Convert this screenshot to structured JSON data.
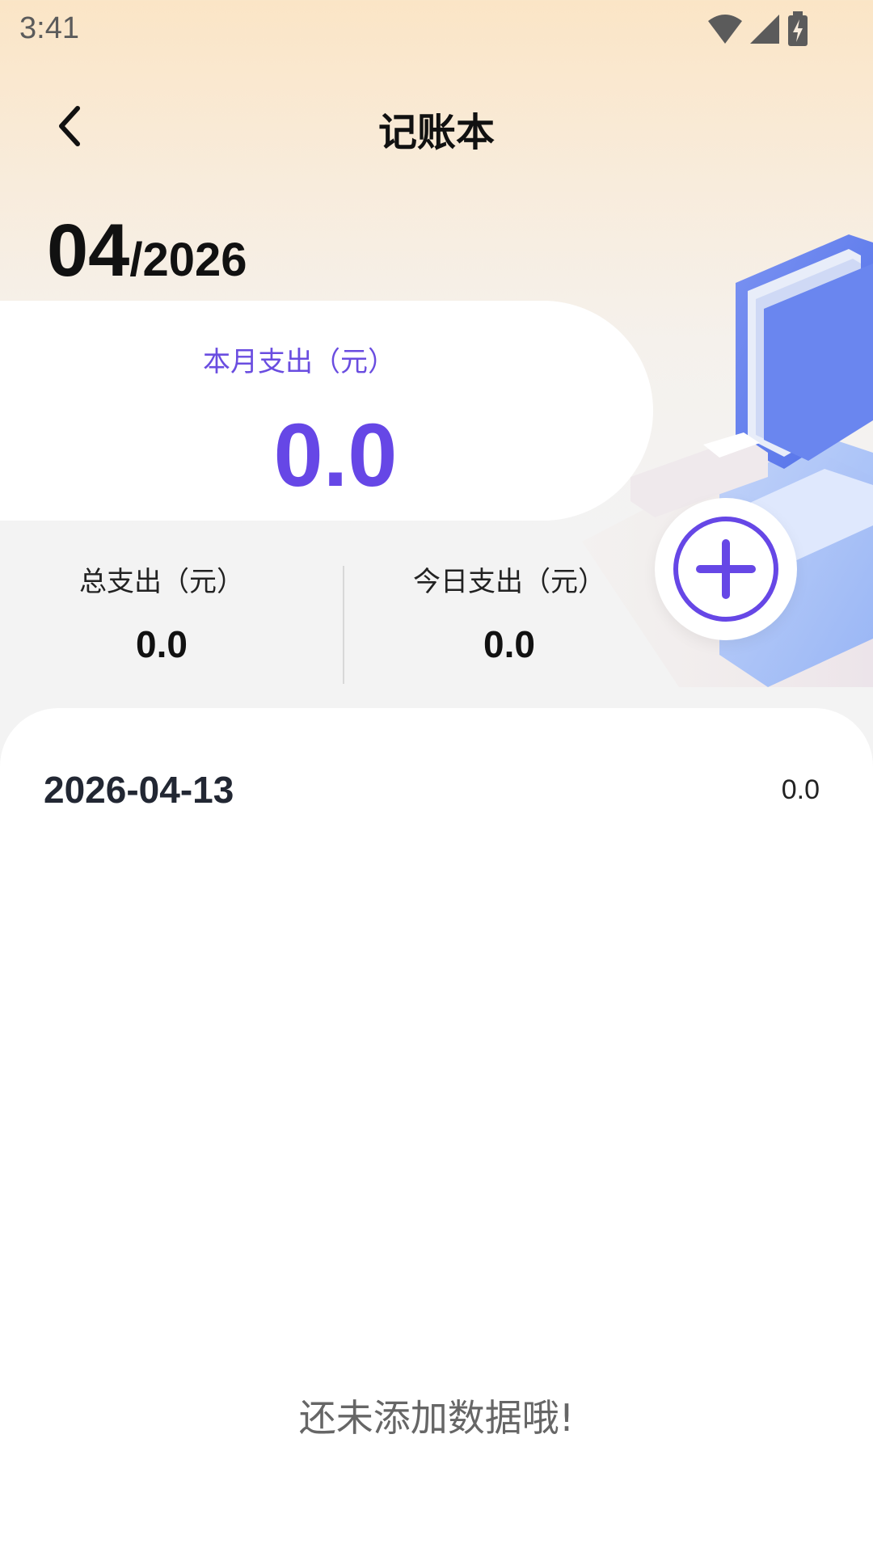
{
  "status_bar": {
    "time": "3:41"
  },
  "header": {
    "title": "记账本"
  },
  "date": {
    "month": "04",
    "separator": "/",
    "year": "2026"
  },
  "monthly": {
    "label": "本月支出（元）",
    "value": "0.0"
  },
  "stats": {
    "total_label": "总支出（元）",
    "total_value": "0.0",
    "today_label": "今日支出（元）",
    "today_value": "0.0"
  },
  "records": {
    "date": "2026-04-13",
    "amount": "0.0",
    "empty_message": "还未添加数据哦!"
  },
  "colors": {
    "accent": "#6647e6",
    "header_gradient_top": "#fbe5c6",
    "background": "#f3f3f3"
  },
  "icons": {
    "back": "chevron-left-icon",
    "add": "plus-circle-icon",
    "wifi": "wifi-icon",
    "signal": "signal-icon",
    "battery": "battery-charging-icon"
  }
}
